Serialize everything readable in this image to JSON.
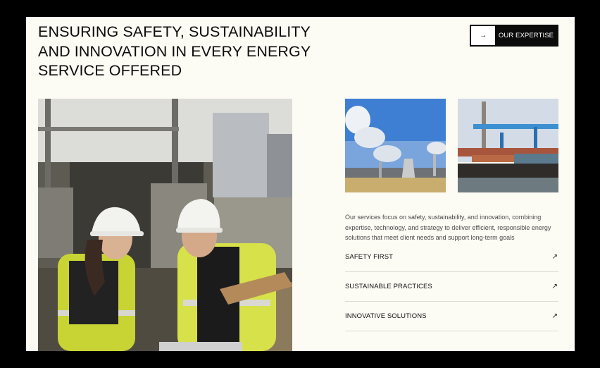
{
  "hero": {
    "headline": "ENSURING SAFETY, SUSTAINABILITY AND INNOVATION IN EVERY ENERGY SERVICE OFFERED",
    "cta_label": "OUR EXPERTISE",
    "cta_icon": "arrow-right-icon"
  },
  "images": {
    "main_photo": "engineers-in-hard-hats-photo",
    "thumb_1": "power-plant-smokestacks-photo",
    "thumb_2": "industrial-port-cranes-photo"
  },
  "services": {
    "description": "Our services focus on safety, sustainability, and innovation, combining expertise, technology, and strategy to deliver efficient, responsible energy solutions that meet client needs and support long-term goals",
    "features": [
      {
        "label": "SAFETY FIRST",
        "icon": "arrow-up-right-icon"
      },
      {
        "label": "SUSTAINABLE PRACTICES",
        "icon": "arrow-up-right-icon"
      },
      {
        "label": "INNOVATIVE SOLUTIONS",
        "icon": "arrow-up-right-icon"
      }
    ]
  },
  "colors": {
    "page_background": "#fcfbf4",
    "text": "#0c0c0c",
    "button": "#0b0b0b",
    "divider": "#dcdad2"
  }
}
